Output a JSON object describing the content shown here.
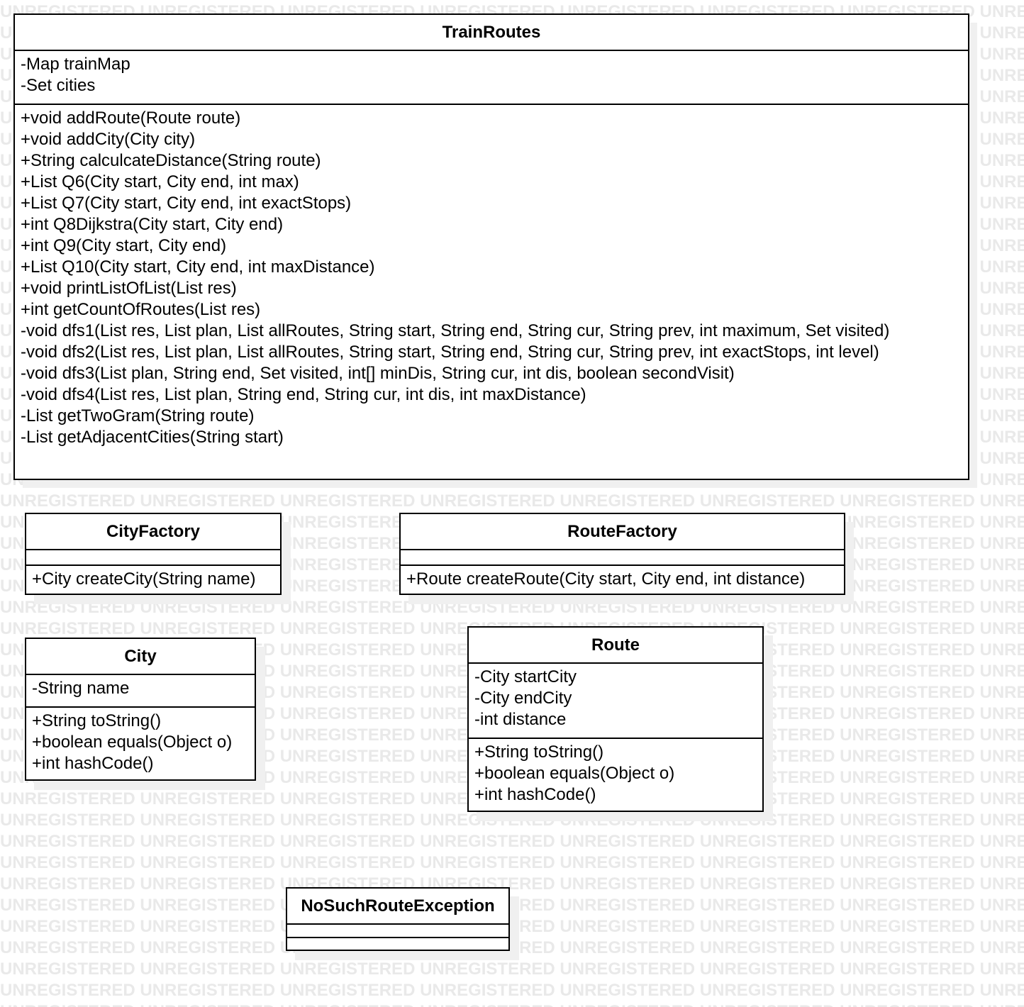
{
  "watermark": {
    "text": "UNREGISTERED"
  },
  "classes": {
    "train_routes": {
      "name": "TrainRoutes",
      "attributes": [
        "-Map trainMap",
        "-Set cities"
      ],
      "operations": [
        "+void addRoute(Route route)",
        "+void addCity(City city)",
        "+String calculcateDistance(String route)",
        "+List Q6(City start, City end, int max)",
        "+List Q7(City start, City end, int exactStops)",
        "+int Q8Dijkstra(City start, City end)",
        "+int Q9(City start, City end)",
        "+List Q10(City start, City end, int maxDistance)",
        "+void printListOfList(List res)",
        "+int getCountOfRoutes(List res)",
        "-void dfs1(List res, List plan, List allRoutes, String start, String end, String cur, String prev, int maximum, Set visited)",
        "-void dfs2(List res, List plan, List allRoutes, String start, String end, String cur, String prev, int exactStops, int level)",
        "-void dfs3(List plan, String end, Set visited, int[] minDis, String cur, int dis, boolean secondVisit)",
        "-void dfs4(List res, List plan, String end, String cur, int dis, int maxDistance)",
        "-List getTwoGram(String route)",
        "-List getAdjacentCities(String start)"
      ]
    },
    "city_factory": {
      "name": "CityFactory",
      "attributes": [],
      "operations": [
        "+City createCity(String name)"
      ]
    },
    "route_factory": {
      "name": "RouteFactory",
      "attributes": [],
      "operations": [
        "+Route createRoute(City start, City end, int distance)"
      ]
    },
    "city": {
      "name": "City",
      "attributes": [
        "-String name"
      ],
      "operations": [
        "+String toString()",
        "+boolean equals(Object o)",
        "+int hashCode()"
      ]
    },
    "route": {
      "name": "Route",
      "attributes": [
        "-City startCity",
        "-City endCity",
        "-int distance"
      ],
      "operations": [
        "+String toString()",
        "+boolean equals(Object o)",
        "+int hashCode()"
      ]
    },
    "no_such_route_exception": {
      "name": "NoSuchRouteException",
      "attributes": [],
      "operations": []
    }
  }
}
